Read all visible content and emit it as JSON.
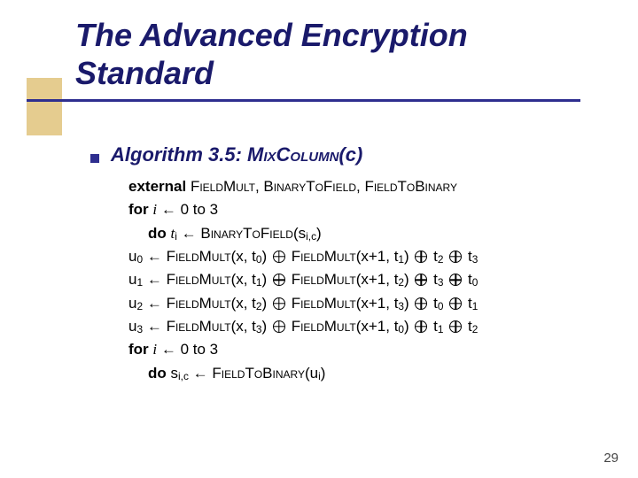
{
  "title_line1": "The Advanced Encryption",
  "title_line2": "Standard",
  "algo_label": "Algorithm 3.5:",
  "algo_name": "MixColumn",
  "algo_arg": "(c)",
  "external_kw": "external",
  "external_list_1": "FieldMult",
  "external_list_2": "BinaryToField",
  "external_list_3": "FieldToBinary",
  "for_kw": "for",
  "for_range": "to 3",
  "do_kw": "do",
  "btf": "BinaryToField",
  "btf_arg": "(s",
  "btf_arg_sub": "i,c",
  "btf_arg_close": ")",
  "fm": "FieldMult",
  "u0": "u",
  "u0s": "0",
  "u1": "u",
  "u1s": "1",
  "u2": "u",
  "u2s": "2",
  "u3": "u",
  "u3s": "3",
  "xt0": "(x, t",
  "xt0s": "0",
  "xtc": ")",
  "xt1": "(x, t",
  "xt1s": "1",
  "xt2": "(x, t",
  "xt2s": "2",
  "xt3": "(x, t",
  "xt3s": "3",
  "xp1t1": "(x+1, t",
  "xp1t1s": "1",
  "xp1t2": "(x+1, t",
  "xp1t2s": "2",
  "xp1t3": "(x+1, t",
  "xp1t3s": "3",
  "xp1t0": "(x+1, t",
  "xp1t0s": "0",
  "t0": " t",
  "t0s": "0",
  "t1": " t",
  "t1s": "1",
  "t2": " t",
  "t2s": "2",
  "t3": " t",
  "t3s": "3",
  "ftb": "FieldToBinary",
  "do2_lhs": "s",
  "do2_lhs_sub": "i,c",
  "ftb_arg": "(u",
  "ftb_arg_sub": "i",
  "ftb_arg_close": ")",
  "ivar": "i",
  "assign0": " ← 0 ",
  "ti": "t",
  "tis": "i",
  "page": "29"
}
